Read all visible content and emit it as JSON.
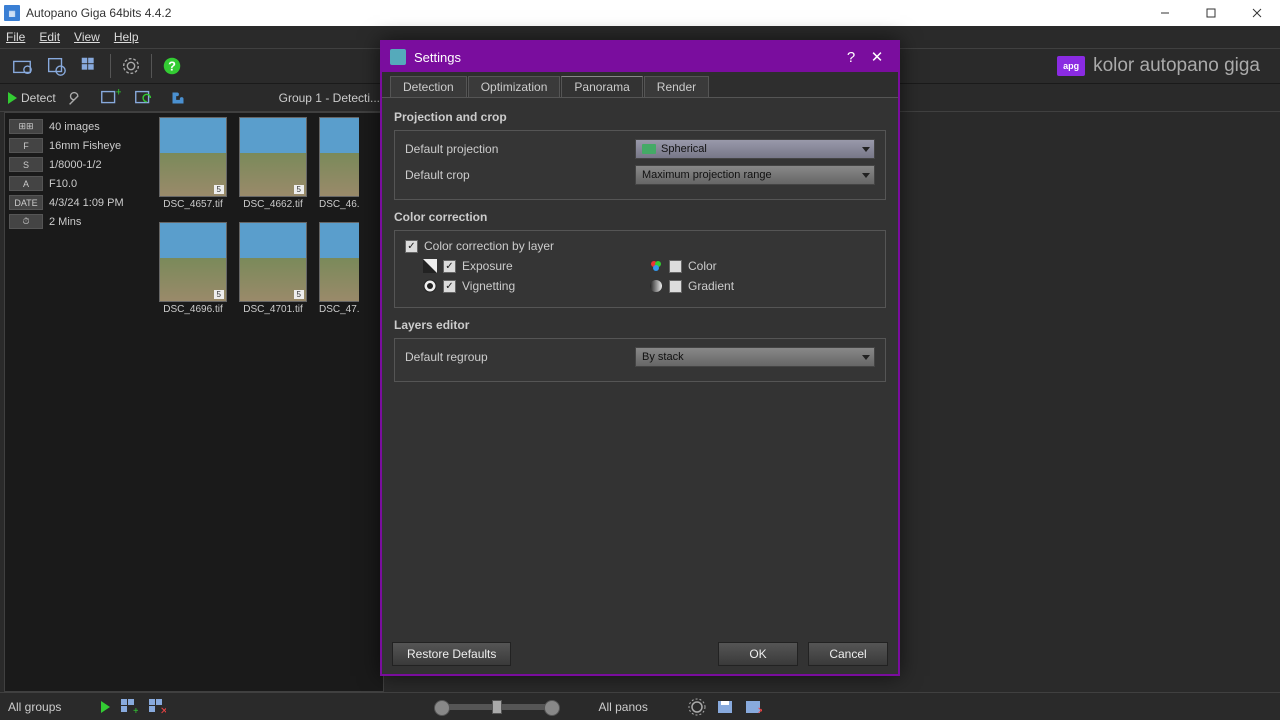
{
  "window": {
    "title": "Autopano Giga 64bits 4.4.2"
  },
  "menu": {
    "file": "File",
    "edit": "Edit",
    "view": "View",
    "help": "Help"
  },
  "brand": {
    "logo": "apg",
    "text": "kolor autopano giga"
  },
  "subtoolbar": {
    "detect": "Detect",
    "group": "Group 1 - Detecti..."
  },
  "groupPanel": {
    "meta": {
      "imagesBadge": "⊞⊞",
      "images": "40 images",
      "fBadge": "F",
      "lens": "16mm Fisheye",
      "sBadge": "S",
      "shutter": "1/8000-1/2",
      "aBadge": "A",
      "aperture": "F10.0",
      "dateBadge": "DATE",
      "date": "4/3/24 1:09 PM",
      "timeBadge": "⏱",
      "time": "2 Mins"
    },
    "thumbs": [
      {
        "name": "DSC_4657.tif"
      },
      {
        "name": "DSC_4662.tif"
      },
      {
        "name": "DSC_46..."
      },
      {
        "name": "DSC_4696.tif"
      },
      {
        "name": "DSC_4701.tif"
      },
      {
        "name": "DSC_47..."
      }
    ]
  },
  "dialog": {
    "title": "Settings",
    "tabs": {
      "detection": "Detection",
      "optimization": "Optimization",
      "panorama": "Panorama",
      "render": "Render"
    },
    "sections": {
      "projCrop": {
        "title": "Projection and crop",
        "defaultProjectionLabel": "Default projection",
        "defaultProjectionValue": "Spherical",
        "defaultCropLabel": "Default crop",
        "defaultCropValue": "Maximum projection range"
      },
      "colorCorrection": {
        "title": "Color correction",
        "byLayer": "Color correction by layer",
        "exposure": "Exposure",
        "vignetting": "Vignetting",
        "color": "Color",
        "gradient": "Gradient"
      },
      "layersEditor": {
        "title": "Layers editor",
        "defaultRegroupLabel": "Default regroup",
        "defaultRegroupValue": "By stack"
      }
    },
    "buttons": {
      "restore": "Restore Defaults",
      "ok": "OK",
      "cancel": "Cancel"
    }
  },
  "statusbar": {
    "allGroups": "All groups",
    "allPanos": "All panos"
  }
}
